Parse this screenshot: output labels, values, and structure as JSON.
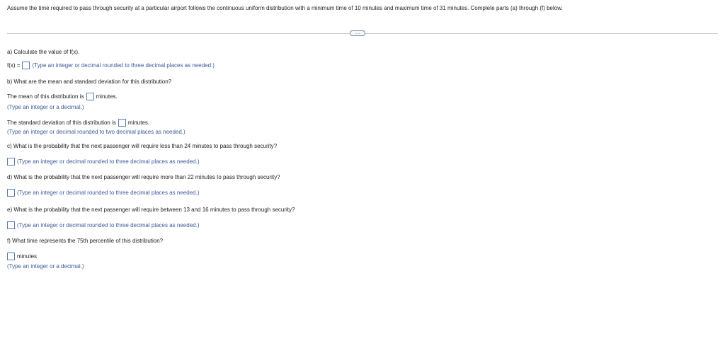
{
  "stem": "Assume the time required to pass through security at a particular airport follows the continuous uniform distribution with a minimum time of 10 minutes and maximum time of 31 minutes. Complete parts (a) through (f) below.",
  "more_button": "…",
  "a": {
    "question": "a) Calculate the value of f(x).",
    "prefix": "f(x) =",
    "hint": "(Type an integer or decimal rounded to three decimal places as needed.)"
  },
  "b": {
    "question": "b) What are the mean and standard deviation for this distribution?",
    "mean_prefix": "The mean of this distribution is",
    "mean_suffix": "minutes.",
    "mean_hint": "(Type an integer or a decimal.)",
    "sd_prefix": "The standard deviation of this distribution is",
    "sd_suffix": "minutes.",
    "sd_hint": "(Type an integer or decimal rounded to two decimal places as needed.)"
  },
  "c": {
    "question": "c) What is the probability that the next passenger will require less than 24 minutes to pass through security?",
    "hint": "(Type an integer or decimal rounded to three decimal places as needed.)"
  },
  "d": {
    "question": "d) What is the probability that the next passenger will require more than 22 minutes to pass through security?",
    "hint": "(Type an integer or decimal rounded to three decimal places as needed.)"
  },
  "e": {
    "question": "e) What is the probability that the next passenger will require between 13 and 16 minutes to pass through security?",
    "hint": "(Type an integer or decimal rounded to three decimal places as needed.)"
  },
  "f": {
    "question": "f) What time represents the 75th percentile of this distribution?",
    "suffix": "minutes",
    "hint": "(Type an integer or a decimal.)"
  }
}
